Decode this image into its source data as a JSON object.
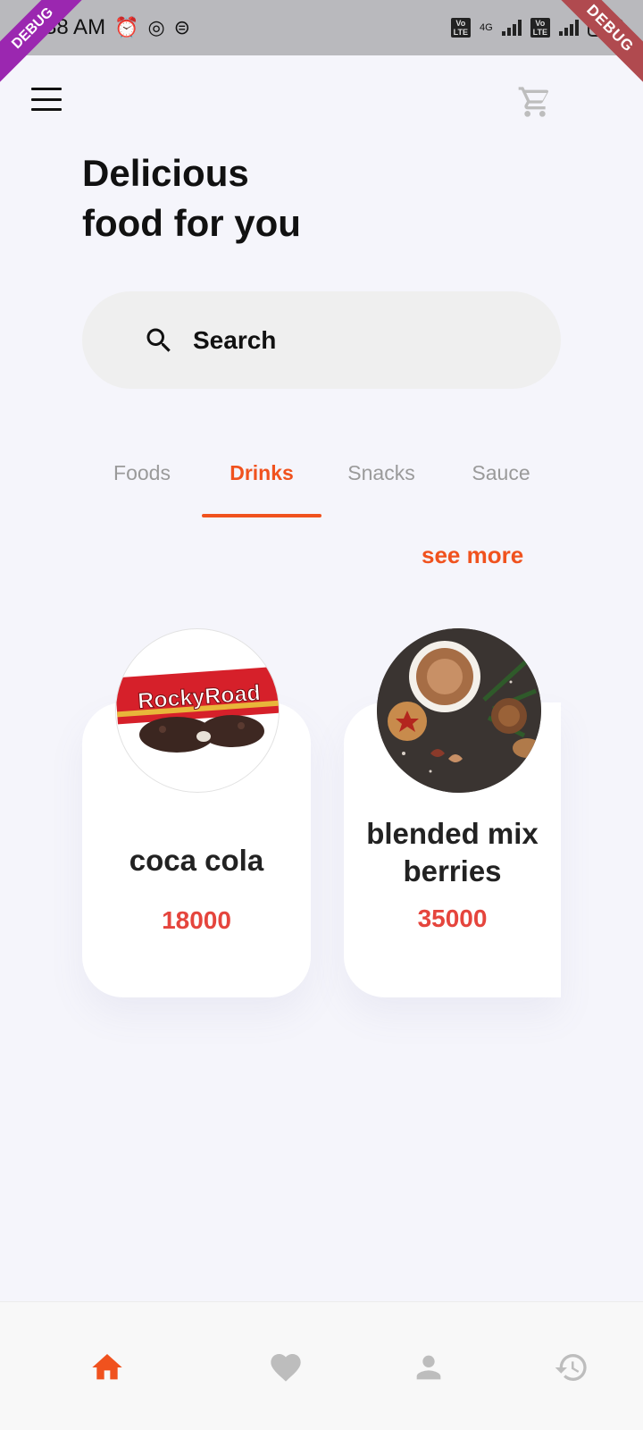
{
  "status_bar": {
    "time": "9:38 AM",
    "network_type": "4G",
    "lte_label": "Vo LTE",
    "battery_level": "4"
  },
  "debug": {
    "left_label": "DEBUG",
    "right_label": "DEBUG"
  },
  "header": {
    "title_line1": "Delicious",
    "title_line2": "food for you"
  },
  "search": {
    "placeholder": "Search"
  },
  "tabs": [
    {
      "label": "Foods",
      "active": false
    },
    {
      "label": "Drinks",
      "active": true
    },
    {
      "label": "Snacks",
      "active": false
    },
    {
      "label": "Sauce",
      "active": false
    }
  ],
  "see_more_label": "see more",
  "products": [
    {
      "name": "coca cola",
      "price": "18000",
      "image_text": "RockyRoad"
    },
    {
      "name": "blended mix berries",
      "price": "35000"
    }
  ],
  "bottom_nav": [
    {
      "icon": "home-icon",
      "active": true
    },
    {
      "icon": "heart-icon",
      "active": false
    },
    {
      "icon": "person-icon",
      "active": false
    },
    {
      "icon": "history-icon",
      "active": false
    }
  ],
  "colors": {
    "accent": "#F0521E",
    "price": "#E5453D",
    "background": "#F5F5FB",
    "inactive_icon": "#BDBDBD"
  }
}
